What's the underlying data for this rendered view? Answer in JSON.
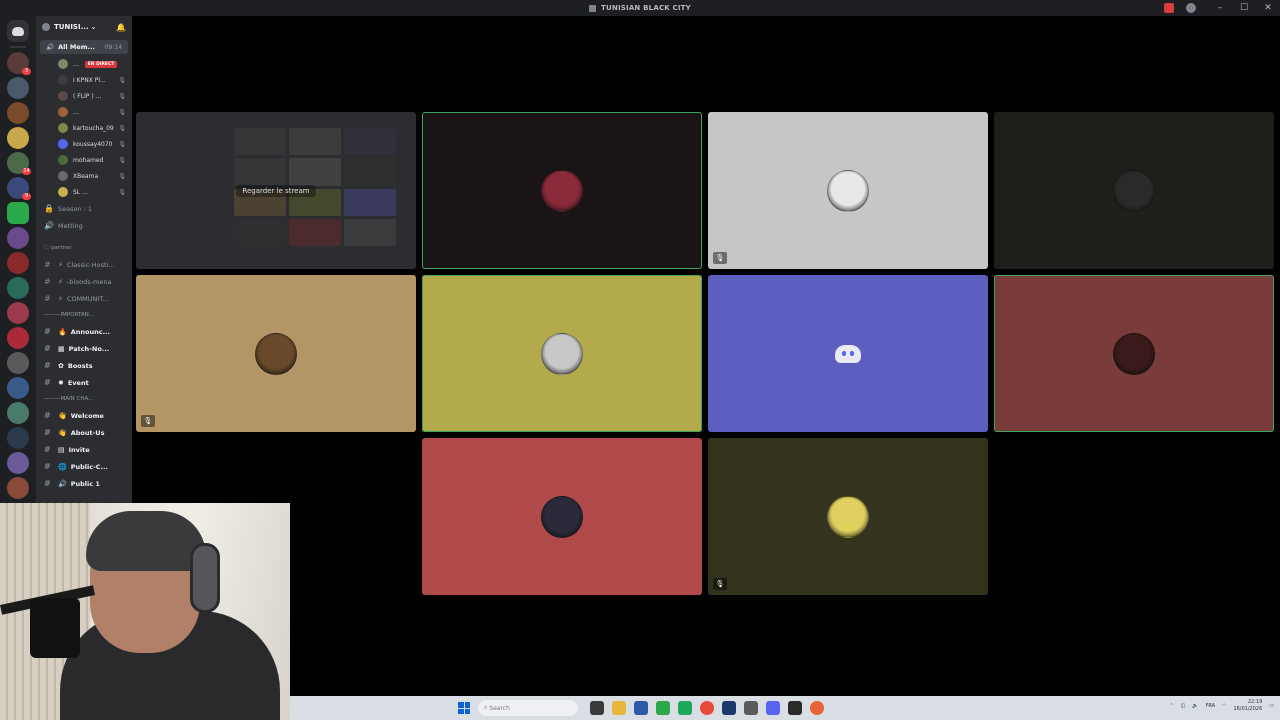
{
  "window": {
    "title": "TUNISIAN BLACK CITY"
  },
  "server": {
    "name": "TUNISI..."
  },
  "voice_channel": {
    "name": "All Mem...",
    "timer": "09:14"
  },
  "members": [
    {
      "name": "...",
      "status": "EN DIRECT",
      "color": "#7a8a6a"
    },
    {
      "name": "I KPNX Pl...",
      "color": "#3c3d42"
    },
    {
      "name": "( FLIP ) ...",
      "color": "#5a4a4a"
    },
    {
      "name": "...",
      "color": "#a0603a"
    },
    {
      "name": "kartoucha_09",
      "color": "#7d8a4a"
    },
    {
      "name": "koussay4070",
      "color": "#5865f2"
    },
    {
      "name": "mohamed",
      "color": "#4e6a3a"
    },
    {
      "name": "XBeama",
      "color": "#6a6a6a"
    },
    {
      "name": "SL ...",
      "color": "#c9b04a"
    }
  ],
  "voice_channels": [
    {
      "name": "Season : 1"
    },
    {
      "name": "Metting"
    }
  ],
  "categories": {
    "partner": "partner",
    "important": "IMPORTAN...",
    "main": "MAIN CHA..."
  },
  "partner_channels": [
    {
      "name": "Classic-Hosti..."
    },
    {
      "name": "-bloods-mena"
    },
    {
      "name": "COMMUNIT..."
    }
  ],
  "important_channels": [
    {
      "name": "Announc...",
      "emoji": "🔥"
    },
    {
      "name": "Patch-No...",
      "emoji": "▦"
    },
    {
      "name": "Boosts",
      "emoji": "✿"
    },
    {
      "name": "Event",
      "emoji": "✸"
    }
  ],
  "main_channels": [
    {
      "name": "Welcome",
      "emoji": "👋"
    },
    {
      "name": "About-Us",
      "emoji": "👋"
    },
    {
      "name": "Invite",
      "emoji": "▤"
    },
    {
      "name": "Public-C...",
      "emoji": "🌐"
    },
    {
      "name": "Public 1",
      "emoji": "🔊"
    }
  ],
  "stage": {
    "stream_button": "Regarder le stream"
  },
  "tiles": [
    {
      "bg": "#2b2d31",
      "avatar": "stream-preview"
    },
    {
      "bg": "#1a1417",
      "avatar": "#8a2a3a",
      "speaking": true
    },
    {
      "bg": "#c6c6c6",
      "avatar": "#e8e8e8",
      "muted": true
    },
    {
      "bg": "#1e1f1a",
      "avatar": "#2a2a2a"
    },
    {
      "bg": "#b39566",
      "avatar": "#6a4a2a",
      "muted": true
    },
    {
      "bg": "#b3aa4c",
      "avatar": "#c8c8c8",
      "speaking": true
    },
    {
      "bg": "#5c5fc0",
      "avatar": "discord-default"
    },
    {
      "bg": "#7a3b3b",
      "avatar": "#3a1a1a",
      "speaking": true
    },
    {
      "bg": "#b04a4a",
      "avatar": "#2a2a3a"
    },
    {
      "bg": "#34341e",
      "avatar": "#e0d060",
      "muted": true
    }
  ],
  "taskbar": {
    "search_placeholder": "Search",
    "lang": "FRA",
    "time": "22:19",
    "date": "16/01/2026"
  }
}
